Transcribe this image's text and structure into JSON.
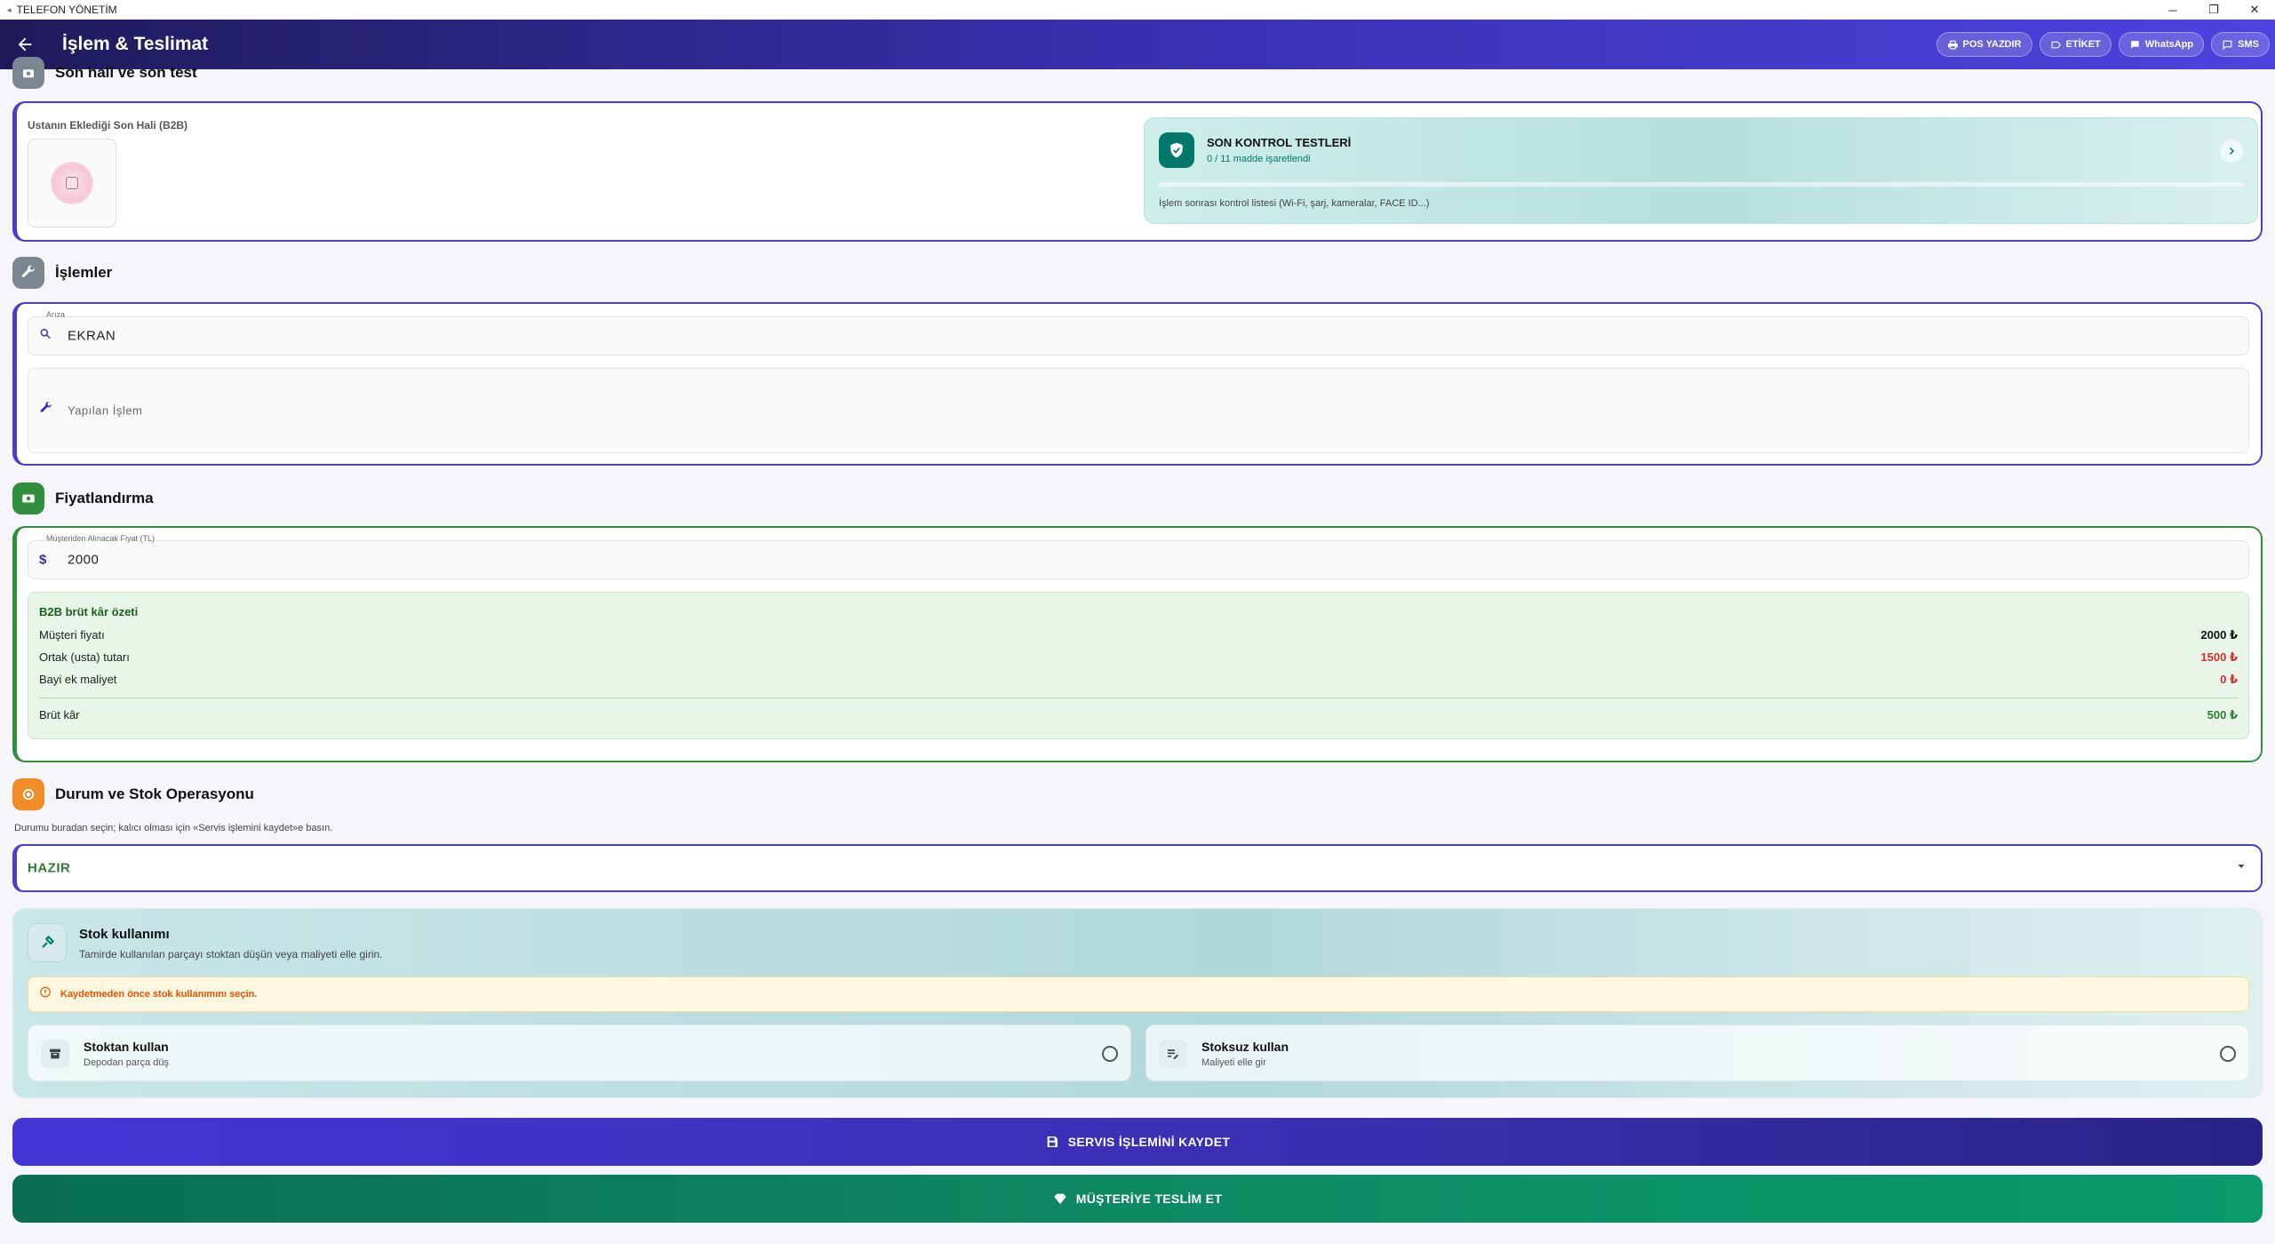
{
  "window": {
    "title": "TELEFON YÖNETİM"
  },
  "header": {
    "title": "İşlem & Teslimat",
    "buttons": [
      {
        "label": "POS YAZDIR",
        "icon": "printer-icon"
      },
      {
        "label": "ETİKET",
        "icon": "label-icon"
      },
      {
        "label": "WhatsApp",
        "icon": "chat-icon"
      },
      {
        "label": "SMS",
        "icon": "sms-icon"
      }
    ]
  },
  "son_hali": {
    "section_title": "Son hali ve son test",
    "image_label": "Ustanın Eklediği Son Hali (B2B)",
    "control": {
      "title": "SON KONTROL TESTLERİ",
      "subtitle": "0 / 11 madde işaretlendi",
      "progress": 0,
      "description": "İşlem sonrası kontrol listesi (Wi-Fi, şarj, kameralar, FACE ID...)"
    }
  },
  "islemler": {
    "section_title": "İşlemler",
    "ariza_label": "Arıza",
    "ariza_value": "EKRAN",
    "yapilan_placeholder": "Yapılan İşlem"
  },
  "fiyat": {
    "section_title": "Fiyatlandırma",
    "price_label": "Müşteriden Alınacak Fiyat (TL)",
    "price_value": "2000",
    "summary_title": "B2B brüt kâr özeti",
    "rows": [
      {
        "label": "Müşteri fiyatı",
        "value": "2000 ₺",
        "color": "#111111"
      },
      {
        "label": "Ortak (usta) tutarı",
        "value": "1500 ₺",
        "color": "#d32f2f"
      },
      {
        "label": "Bayi ek maliyet",
        "value": "0 ₺",
        "color": "#d32f2f"
      }
    ],
    "total_label": "Brüt kâr",
    "total_value": "500 ₺",
    "total_color": "#2e7d32"
  },
  "durum": {
    "section_title": "Durum ve Stok Operasyonu",
    "hint": "Durumu buradan seçin; kalıcı olması için «Servis işlemini kaydet»e basın.",
    "status_value": "HAZIR",
    "stok": {
      "title": "Stok kullanımı",
      "subtitle": "Tamirde kullanılan parçayı stoktan düşün veya maliyeti elle girin.",
      "warning": "Kaydetmeden önce stok kullanımını seçin.",
      "options": [
        {
          "title": "Stoktan kullan",
          "subtitle": "Depodan parça düş",
          "icon": "inventory-icon"
        },
        {
          "title": "Stoksuz kullan",
          "subtitle": "Maliyeti elle gir",
          "icon": "edit-list-icon"
        }
      ]
    }
  },
  "actions": {
    "save_label": "SERVIS İŞLEMİNİ KAYDET",
    "deliver_label": "MÜŞTERİYE TESLİM ET"
  },
  "colors": {
    "primary": "#3a2fb0",
    "green": "#2f8f3a",
    "orange": "#f28c28",
    "teal": "#00796b"
  }
}
